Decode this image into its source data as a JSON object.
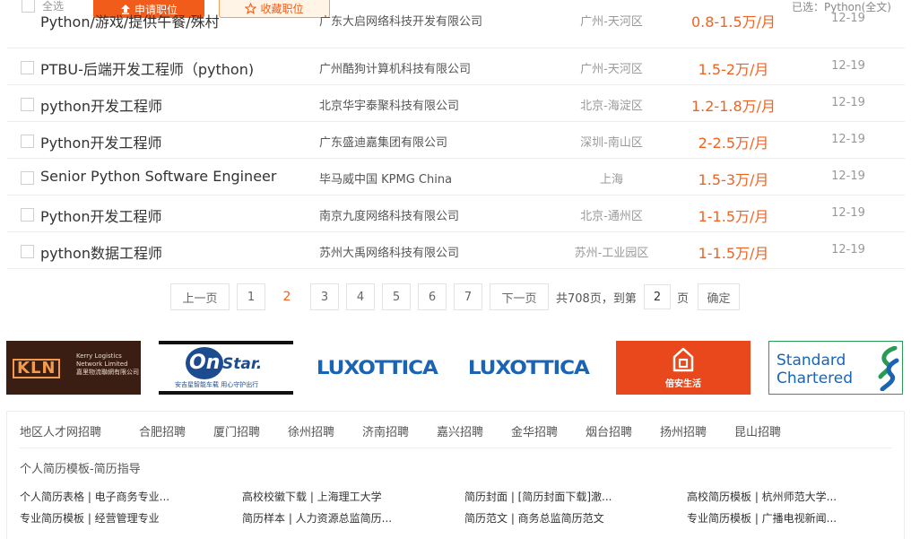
{
  "toolbar": {
    "select_all_label": "全选",
    "apply_label": "申请职位",
    "favorite_label": "收藏职位",
    "selected_label": "已选：Python(全文)"
  },
  "jobs": [
    {
      "title": "Python/游戏/提供午餐/殊村",
      "company": "广东大启网络科技开发有限公司",
      "location": "广州-天河区",
      "salary": "0.8-1.5万/月",
      "date": "12-19"
    },
    {
      "title": "PTBU-后端开发工程师（python)",
      "company": "广州酷狗计算机科技有限公司",
      "location": "广州-天河区",
      "salary": "1.5-2万/月",
      "date": "12-19"
    },
    {
      "title": "python开发工程师",
      "company": "北京华宇泰聚科技有限公司",
      "location": "北京-海淀区",
      "salary": "1.2-1.8万/月",
      "date": "12-19"
    },
    {
      "title": "Python开发工程师",
      "company": "广东盛迪嘉集团有限公司",
      "location": "深圳-南山区",
      "salary": "2-2.5万/月",
      "date": "12-19"
    },
    {
      "title": "Senior Python Software Engineer",
      "company": "毕马威中国 KPMG China",
      "location": "上海",
      "salary": "1.5-3万/月",
      "date": "12-19"
    },
    {
      "title": "Python开发工程师",
      "company": "南京九度网络科技有限公司",
      "location": "北京-通州区",
      "salary": "1-1.5万/月",
      "date": "12-19"
    },
    {
      "title": "python数据工程师",
      "company": "苏州大禹网络科技有限公司",
      "location": "苏州-工业园区",
      "salary": "1-1.5万/月",
      "date": "12-19"
    }
  ],
  "pagination": {
    "prev_label": "上一页",
    "pages": [
      "1",
      "2",
      "3",
      "4",
      "5",
      "6",
      "7"
    ],
    "current_page": "2",
    "next_label": "下一页",
    "total_text": "共708页，到第",
    "goto_value": "2",
    "page_unit": "页",
    "confirm_label": "确定"
  },
  "logos": {
    "kln_mark": "KLN",
    "kln_line1": "Kerry Logistics",
    "kln_line2": "Network Limited",
    "kln_line3": "嘉里物流聯網有限公司",
    "onstar_on": "On",
    "onstar_star": "Star.",
    "onstar_sub": "安吉星智能车载  用心守护出行",
    "luxottica_1": "LUXOTTICA",
    "luxottica_2": "LUXOTTICA",
    "anjia": "倍安生活",
    "sc_line1": "Standard",
    "sc_line2": "Chartered"
  },
  "footer": {
    "region_title": "地区人才网招聘",
    "region_links": [
      "合肥招聘",
      "厦门招聘",
      "徐州招聘",
      "济南招聘",
      "嘉兴招聘",
      "金华招聘",
      "烟台招聘",
      "扬州招聘",
      "昆山招聘"
    ],
    "resume_title": "个人简历模板-简历指导",
    "resume_links": [
      [
        "个人简历表格 | 电子商务专业...",
        "高校校徽下载 | 上海理工大学",
        "简历封面 | [简历封面下载]澈...",
        "高校简历模板 | 杭州师范大学..."
      ],
      [
        "专业简历模板 | 经营管理专业",
        "简历样本 | 人力资源总监简历...",
        "简历范文 | 商务总监简历范文",
        "专业简历模板 | 广播电视新闻..."
      ]
    ]
  },
  "colors": {
    "accent_orange": "#f25c1a",
    "salary_orange": "#f2621f",
    "luxottica_blue": "#1b64b3"
  }
}
